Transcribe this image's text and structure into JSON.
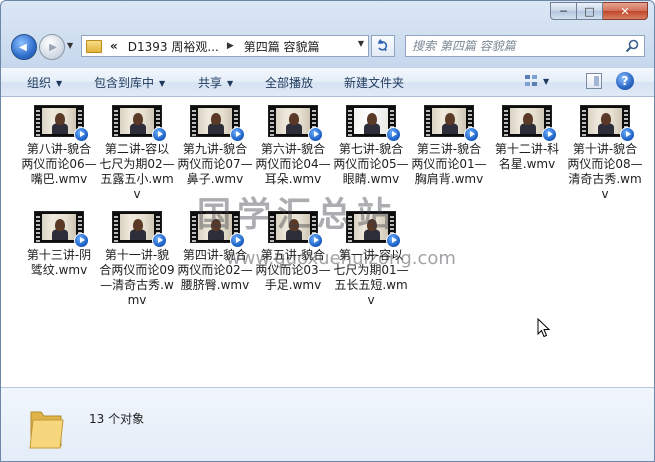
{
  "window": {
    "caption_buttons": {
      "minimize": "─",
      "maximize": "□",
      "close": "✕"
    }
  },
  "nav": {
    "back_glyph": "◀",
    "forward_glyph": "▶",
    "address_overflow": "«",
    "address_segments": [
      "D1393 周裕观...",
      "第四篇 容貌篇"
    ],
    "search_placeholder": "搜索 第四篇 容貌篇"
  },
  "toolbar": {
    "organize": "组织",
    "include_in_library": "包含到库中",
    "share": "共享",
    "play_all": "全部播放",
    "new_folder": "新建文件夹",
    "help": "?"
  },
  "files": [
    {
      "name": "第八讲-貌合两仪而论06—嘴巴.wmv",
      "thumb": "dark"
    },
    {
      "name": "第二讲-容以七尺为期02—五露五小.wmv",
      "thumb": "dark"
    },
    {
      "name": "第九讲-貌合两仪而论07—鼻子.wmv",
      "thumb": "dark"
    },
    {
      "name": "第六讲-貌合两仪而论04—耳朵.wmv",
      "thumb": "dark"
    },
    {
      "name": "第七讲-貌合两仪而论05—眼睛.wmv",
      "thumb": "alt"
    },
    {
      "name": "第三讲-貌合两仪而论01—胸肩背.wmv",
      "thumb": "dark"
    },
    {
      "name": "第十二讲-科名星.wmv",
      "thumb": "dark"
    },
    {
      "name": "第十讲-貌合两仪而论08—清奇古秀.wmv",
      "thumb": "dark"
    },
    {
      "name": "第十三讲-阴骘纹.wmv",
      "thumb": "dark"
    },
    {
      "name": "第十一讲-貌合两仪而论09—清奇古秀.wmv",
      "thumb": "dark"
    },
    {
      "name": "第四讲-貌合两仪而论02—腰脐臀.wmv",
      "thumb": "dark"
    },
    {
      "name": "第五讲-貌合两仪而论03—手足.wmv",
      "thumb": "dark"
    },
    {
      "name": "第一讲-容以七尺为期01—五长五短.wmv",
      "thumb": "dark"
    }
  ],
  "watermark": {
    "text": "国学汇总站",
    "url": "www.guoxuehuizong.com"
  },
  "details": {
    "count_text": "13 个对象"
  }
}
